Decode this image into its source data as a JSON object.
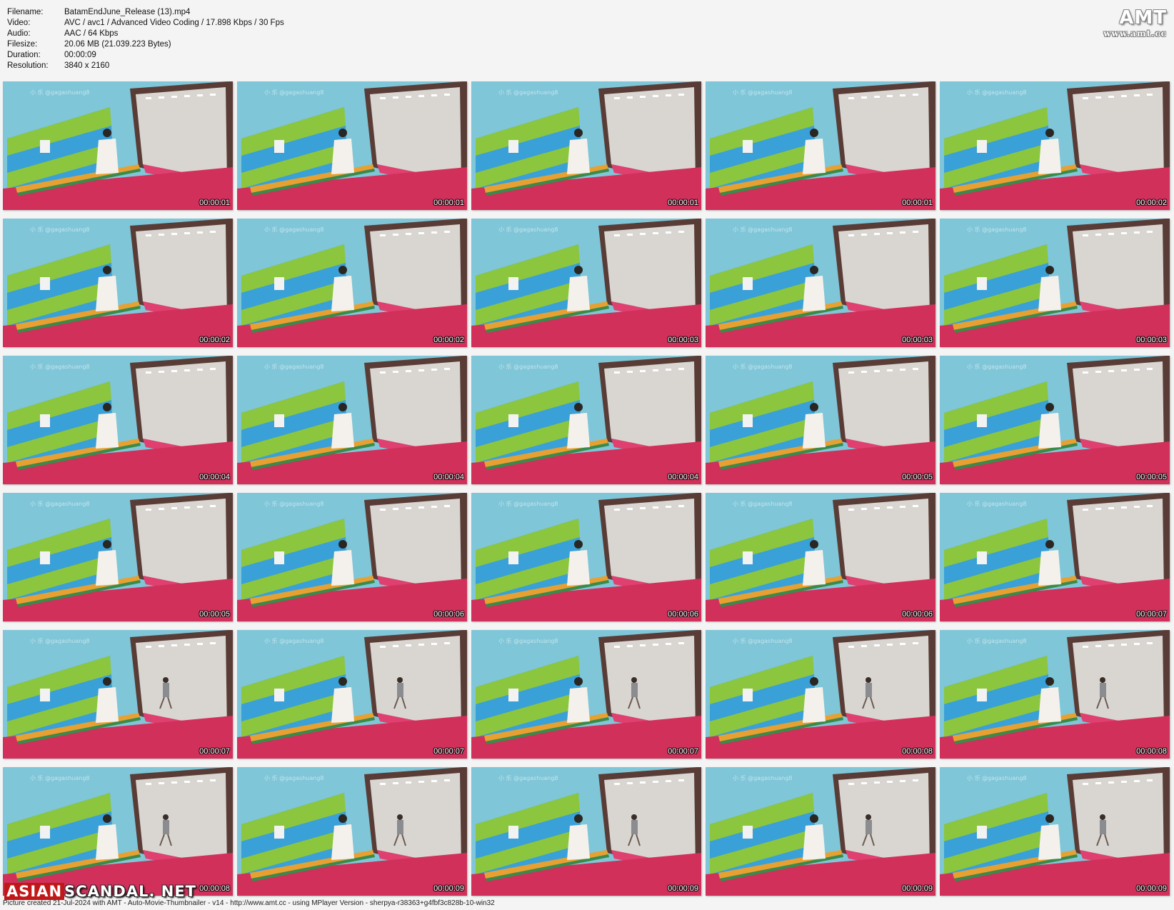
{
  "info": [
    {
      "key": "Filename:",
      "value": "BatamEndJune_Release (13).mp4"
    },
    {
      "key": "Video:",
      "value": "AVC / avc1 / Advanced Video Coding / 17.898 Kbps / 30 Fps"
    },
    {
      "key": "Audio:",
      "value": "AAC / 64 Kbps"
    },
    {
      "key": "Filesize:",
      "value": "20.06 MB (21.039.223 Bytes)"
    },
    {
      "key": "Duration:",
      "value": "00:00:09"
    },
    {
      "key": "Resolution:",
      "value": "3840 x 2160"
    }
  ],
  "logo": {
    "main": "AMT",
    "sub": "www.amt.cc"
  },
  "watermark": "小 乐 @gagashuang8",
  "thumbnails": [
    "00:00:01",
    "00:00:01",
    "00:00:01",
    "00:00:01",
    "00:00:02",
    "00:00:02",
    "00:00:02",
    "00:00:03",
    "00:00:03",
    "00:00:03",
    "00:00:04",
    "00:00:04",
    "00:00:04",
    "00:00:05",
    "00:00:05",
    "00:00:05",
    "00:00:06",
    "00:00:06",
    "00:00:06",
    "00:00:07",
    "00:00:07",
    "00:00:07",
    "00:00:07",
    "00:00:08",
    "00:00:08",
    "00:00:08",
    "00:00:09",
    "00:00:09",
    "00:00:09",
    "00:00:09"
  ],
  "brand": {
    "part1": "ASIAN",
    "part2": "SCANDAL",
    "part3": ". NET"
  },
  "footer": "Picture created 21-Jul-2024 with AMT - Auto-Movie-Thumbnailer - v14 - http://www.amt.cc - using MPlayer Version - sherpya-r38363+g4fbf3c828b-10-win32",
  "colors": {
    "wall": "#7fc6d8",
    "locker_green": "#8cc63e",
    "locker_blue": "#3aa0d8",
    "floor": "#d0305a"
  }
}
